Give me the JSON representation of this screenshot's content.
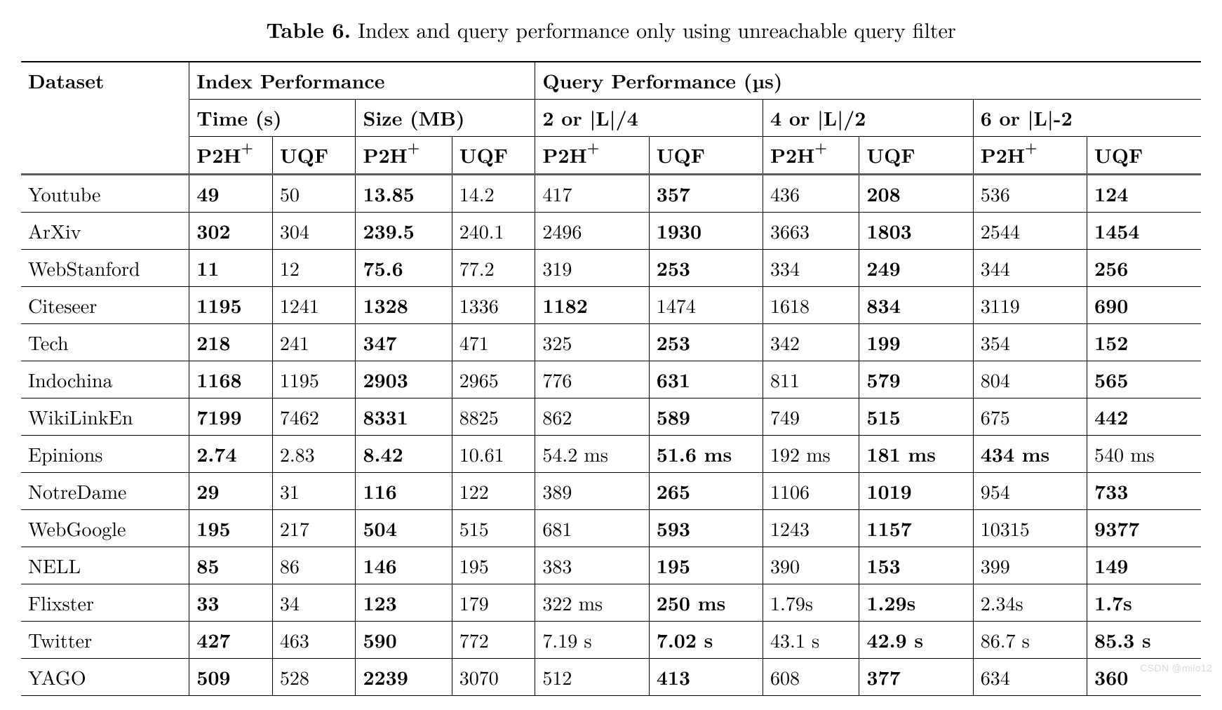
{
  "caption": {
    "label": "Table 6.",
    "text": " Index and query performance only using unreachable query filter"
  },
  "headers": {
    "dataset": "Dataset",
    "index_perf": "Index Performance",
    "query_perf": "Query Performance (µs)",
    "time": "Time (s)",
    "size": "Size (MB)",
    "q1": "2 or |L|/4",
    "q2": "4 or |L|/2",
    "q3": "6 or |L|-2",
    "p2h": "P2H",
    "p2h_sup": "+",
    "uqf": "UQF"
  },
  "rows": [
    {
      "name": "Youtube",
      "t_p2h": "49",
      "t_p2h_b": true,
      "t_uqf": "50",
      "s_p2h": "13.85",
      "s_p2h_b": true,
      "s_uqf": "14.2",
      "q1p": "417",
      "q1p_b": false,
      "q1u": "357",
      "q1u_b": true,
      "q2p": "436",
      "q2p_b": false,
      "q2u": "208",
      "q2u_b": true,
      "q3p": "536",
      "q3p_b": false,
      "q3u": "124",
      "q3u_b": true
    },
    {
      "name": "ArXiv",
      "t_p2h": "302",
      "t_p2h_b": true,
      "t_uqf": "304",
      "s_p2h": "239.5",
      "s_p2h_b": true,
      "s_uqf": "240.1",
      "q1p": "2496",
      "q1p_b": false,
      "q1u": "1930",
      "q1u_b": true,
      "q2p": "3663",
      "q2p_b": false,
      "q2u": "1803",
      "q2u_b": true,
      "q3p": "2544",
      "q3p_b": false,
      "q3u": "1454",
      "q3u_b": true
    },
    {
      "name": "WebStanford",
      "t_p2h": "11",
      "t_p2h_b": true,
      "t_uqf": "12",
      "s_p2h": "75.6",
      "s_p2h_b": true,
      "s_uqf": "77.2",
      "q1p": "319",
      "q1p_b": false,
      "q1u": "253",
      "q1u_b": true,
      "q2p": "334",
      "q2p_b": false,
      "q2u": "249",
      "q2u_b": true,
      "q3p": "344",
      "q3p_b": false,
      "q3u": "256",
      "q3u_b": true
    },
    {
      "name": "Citeseer",
      "t_p2h": "1195",
      "t_p2h_b": true,
      "t_uqf": "1241",
      "s_p2h": "1328",
      "s_p2h_b": true,
      "s_uqf": "1336",
      "q1p": "1182",
      "q1p_b": true,
      "q1u": "1474",
      "q1u_b": false,
      "q2p": "1618",
      "q2p_b": false,
      "q2u": "834",
      "q2u_b": true,
      "q3p": "3119",
      "q3p_b": false,
      "q3u": "690",
      "q3u_b": true
    },
    {
      "name": "Tech",
      "t_p2h": "218",
      "t_p2h_b": true,
      "t_uqf": "241",
      "s_p2h": "347",
      "s_p2h_b": true,
      "s_uqf": "471",
      "q1p": "325",
      "q1p_b": false,
      "q1u": "253",
      "q1u_b": true,
      "q2p": "342",
      "q2p_b": false,
      "q2u": "199",
      "q2u_b": true,
      "q3p": "354",
      "q3p_b": false,
      "q3u": "152",
      "q3u_b": true
    },
    {
      "name": "Indochina",
      "t_p2h": "1168",
      "t_p2h_b": true,
      "t_uqf": "1195",
      "s_p2h": "2903",
      "s_p2h_b": true,
      "s_uqf": "2965",
      "q1p": "776",
      "q1p_b": false,
      "q1u": "631",
      "q1u_b": true,
      "q2p": "811",
      "q2p_b": false,
      "q2u": "579",
      "q2u_b": true,
      "q3p": "804",
      "q3p_b": false,
      "q3u": "565",
      "q3u_b": true
    },
    {
      "name": "WikiLinkEn",
      "t_p2h": "7199",
      "t_p2h_b": true,
      "t_uqf": "7462",
      "s_p2h": "8331",
      "s_p2h_b": true,
      "s_uqf": "8825",
      "q1p": "862",
      "q1p_b": false,
      "q1u": "589",
      "q1u_b": true,
      "q2p": "749",
      "q2p_b": false,
      "q2u": "515",
      "q2u_b": true,
      "q3p": "675",
      "q3p_b": false,
      "q3u": "442",
      "q3u_b": true
    },
    {
      "name": "Epinions",
      "t_p2h": "2.74",
      "t_p2h_b": true,
      "t_uqf": "2.83",
      "s_p2h": "8.42",
      "s_p2h_b": true,
      "s_uqf": "10.61",
      "q1p": "54.2 ms",
      "q1p_b": false,
      "q1u": "51.6 ms",
      "q1u_b": true,
      "q2p": "192 ms",
      "q2p_b": false,
      "q2u": "181 ms",
      "q2u_b": true,
      "q3p": "434 ms",
      "q3p_b": true,
      "q3u": "540 ms",
      "q3u_b": false
    },
    {
      "name": "NotreDame",
      "t_p2h": "29",
      "t_p2h_b": true,
      "t_uqf": "31",
      "s_p2h": "116",
      "s_p2h_b": true,
      "s_uqf": "122",
      "q1p": "389",
      "q1p_b": false,
      "q1u": "265",
      "q1u_b": true,
      "q2p": "1106",
      "q2p_b": false,
      "q2u": "1019",
      "q2u_b": true,
      "q3p": "954",
      "q3p_b": false,
      "q3u": "733",
      "q3u_b": true
    },
    {
      "name": "WebGoogle",
      "t_p2h": "195",
      "t_p2h_b": true,
      "t_uqf": "217",
      "s_p2h": "504",
      "s_p2h_b": true,
      "s_uqf": "515",
      "q1p": "681",
      "q1p_b": false,
      "q1u": "593",
      "q1u_b": true,
      "q2p": "1243",
      "q2p_b": false,
      "q2u": "1157",
      "q2u_b": true,
      "q3p": "10315",
      "q3p_b": false,
      "q3u": "9377",
      "q3u_b": true
    },
    {
      "name": "NELL",
      "t_p2h": "85",
      "t_p2h_b": true,
      "t_uqf": "86",
      "s_p2h": "146",
      "s_p2h_b": true,
      "s_uqf": "195",
      "q1p": "383",
      "q1p_b": false,
      "q1u": "195",
      "q1u_b": true,
      "q2p": "390",
      "q2p_b": false,
      "q2u": "153",
      "q2u_b": true,
      "q3p": "399",
      "q3p_b": false,
      "q3u": "149",
      "q3u_b": true
    },
    {
      "name": "Flixster",
      "t_p2h": "33",
      "t_p2h_b": true,
      "t_uqf": "34",
      "s_p2h": "123",
      "s_p2h_b": true,
      "s_uqf": "179",
      "q1p": "322 ms",
      "q1p_b": false,
      "q1u": "250 ms",
      "q1u_b": true,
      "q2p": "1.79s",
      "q2p_b": false,
      "q2u": "1.29s",
      "q2u_b": true,
      "q3p": "2.34s",
      "q3p_b": false,
      "q3u": "1.7s",
      "q3u_b": true
    },
    {
      "name": "Twitter",
      "t_p2h": "427",
      "t_p2h_b": true,
      "t_uqf": "463",
      "s_p2h": "590",
      "s_p2h_b": true,
      "s_uqf": "772",
      "q1p": "7.19 s",
      "q1p_b": false,
      "q1u": "7.02 s",
      "q1u_b": true,
      "q2p": "43.1 s",
      "q2p_b": false,
      "q2u": "42.9 s",
      "q2u_b": true,
      "q3p": "86.7 s",
      "q3p_b": false,
      "q3u": "85.3 s",
      "q3u_b": true
    },
    {
      "name": "YAGO",
      "t_p2h": "509",
      "t_p2h_b": true,
      "t_uqf": "528",
      "s_p2h": "2239",
      "s_p2h_b": true,
      "s_uqf": "3070",
      "q1p": "512",
      "q1p_b": false,
      "q1u": "413",
      "q1u_b": true,
      "q2p": "608",
      "q2p_b": false,
      "q2u": "377",
      "q2u_b": true,
      "q3p": "634",
      "q3p_b": false,
      "q3u": "360",
      "q3u_b": true
    }
  ],
  "watermark": "CSDN @milo12"
}
